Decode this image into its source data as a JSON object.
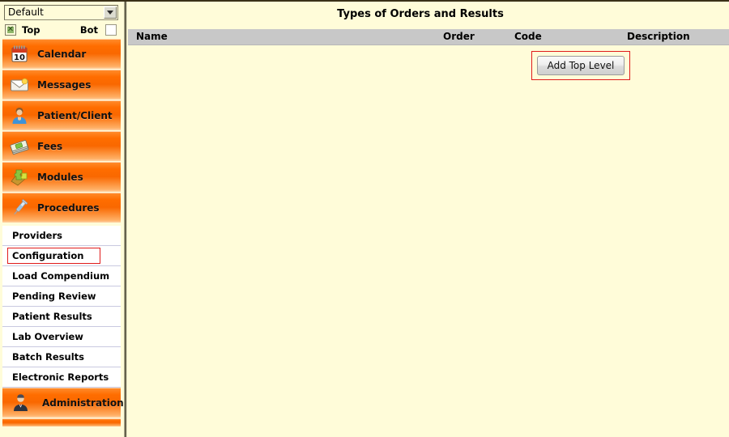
{
  "sidebar": {
    "clinic_select": {
      "value": "Default",
      "icon": "chevron-down-icon"
    },
    "toggles": {
      "top": {
        "label": "Top",
        "checked": true,
        "mark": "☒"
      },
      "bot": {
        "label": "Bot",
        "checked": false
      }
    },
    "nav_items": [
      {
        "label": "Calendar",
        "icon": "calendar-icon"
      },
      {
        "label": "Messages",
        "icon": "envelope-icon"
      },
      {
        "label": "Patient/Client",
        "icon": "person-icon"
      },
      {
        "label": "Fees",
        "icon": "money-icon"
      },
      {
        "label": "Modules",
        "icon": "puzzle-icon"
      },
      {
        "label": "Procedures",
        "icon": "syringe-icon"
      }
    ],
    "sub_items": [
      {
        "label": "Providers",
        "selected": false
      },
      {
        "label": "Configuration",
        "selected": true
      },
      {
        "label": "Load Compendium",
        "selected": false
      },
      {
        "label": "Pending Review",
        "selected": false
      },
      {
        "label": "Patient Results",
        "selected": false
      },
      {
        "label": "Lab Overview",
        "selected": false
      },
      {
        "label": "Batch Results",
        "selected": false
      },
      {
        "label": "Electronic Reports",
        "selected": false
      }
    ],
    "admin_item": {
      "label": "Administration",
      "icon": "suit-person-icon"
    }
  },
  "main": {
    "title": "Types of Orders and Results",
    "columns": [
      {
        "label": "Name"
      },
      {
        "label": "Order"
      },
      {
        "label": "Code"
      },
      {
        "label": "Description"
      }
    ],
    "rows": [],
    "add_button": {
      "label": "Add Top Level",
      "focused": true
    }
  },
  "colors": {
    "page_background": "#FFFCD9",
    "nav_orange": "#FF6D00",
    "header_gray": "#C8C8C8",
    "focus_red": "#E01B1B"
  }
}
